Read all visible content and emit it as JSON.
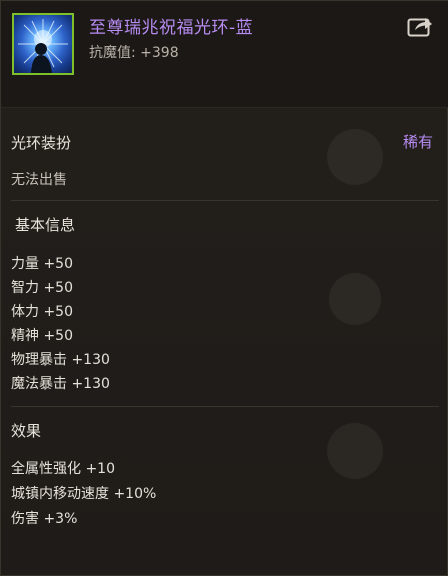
{
  "item": {
    "name": "至尊瑞兆祝福光环-蓝",
    "stat": "抗魔值: +398",
    "icon": "aura-blue-item-icon",
    "name_color": "#b78cf2",
    "border_color": "#7fbf2a"
  },
  "share": {
    "icon": "share-export-icon"
  },
  "category": {
    "title": "光环装扮",
    "rarity": "稀有",
    "trade_status": "无法出售"
  },
  "basic_info": {
    "title": "基本信息",
    "lines": [
      "力量 +50",
      "智力 +50",
      "体力 +50",
      "精神 +50",
      "物理暴击 +130",
      "魔法暴击 +130"
    ]
  },
  "effects": {
    "title": "效果",
    "lines": [
      "全属性强化 +10",
      "城镇内移动速度 +10%",
      "伤害 +3%"
    ]
  }
}
